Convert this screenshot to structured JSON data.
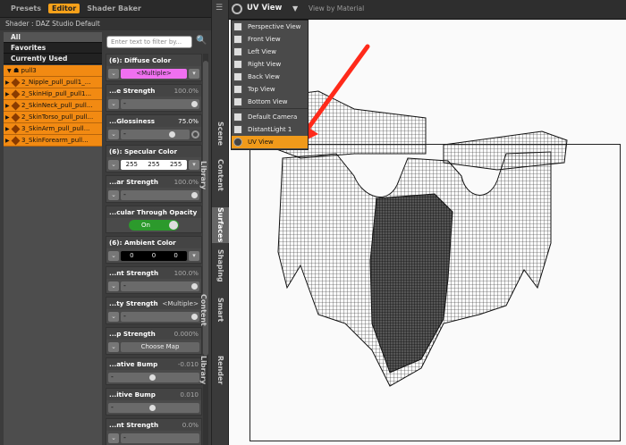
{
  "top_tabs": [
    "Presets",
    "Editor",
    "Shader Baker"
  ],
  "shader_title": "Shader : DAZ Studio Default",
  "filters": [
    "All",
    "Favorites",
    "Currently Used"
  ],
  "tree": {
    "root": "pull3",
    "items": [
      "2_Nipple_pull_pull1_...",
      "2_SkinHip_pull_pull1...",
      "2_SkinNeck_pull_pull...",
      "2_SkinTorso_pull_pull...",
      "3_SkinArm_pull_pull...",
      "3_SkinForearm_pull..."
    ]
  },
  "filter_placeholder": "Enter text to filter by...",
  "props": {
    "diffuse_color": {
      "label": "(6): Diffuse Color",
      "value": "<Multiple>"
    },
    "diffuse_strength": {
      "label": "...e Strength",
      "value": "100.0%"
    },
    "glossiness": {
      "label": "...Glossiness",
      "value": "75.0%"
    },
    "specular_color": {
      "label": "(6): Specular Color",
      "r": "255",
      "g": "255",
      "b": "255"
    },
    "specular_strength": {
      "label": "...ar Strength",
      "value": "100.0%"
    },
    "through_opacity": {
      "label": "...cular Through Opacity",
      "value": "On"
    },
    "ambient_color": {
      "label": "(6): Ambient Color",
      "r": "0",
      "g": "0",
      "b": "0"
    },
    "ambient_strength": {
      "label": "...nt Strength",
      "value": "100.0%"
    },
    "opacity_strength": {
      "label": "...ty Strength",
      "value": "<Multiple>"
    },
    "bump_strength": {
      "label": "...p Strength",
      "value": "0.000%",
      "button": "Choose Map"
    },
    "negative_bump": {
      "label": "...ative Bump",
      "value": "-0.010"
    },
    "positive_bump": {
      "label": "...itive Bump",
      "value": "0.010"
    },
    "last_strength": {
      "label": "...nt Strength",
      "value": "0.0%"
    }
  },
  "side_tabs": [
    "Scene",
    "Content Library",
    "Surfaces",
    "Shaping",
    "Smart Content",
    "Render Library"
  ],
  "viewport": {
    "title": "UV View",
    "mode": "View by Material"
  },
  "view_menu": [
    "Perspective View",
    "Front View",
    "Left View",
    "Right View",
    "Back View",
    "Top View",
    "Bottom View",
    "Default Camera",
    "DistantLight 1",
    "UV View"
  ],
  "colors": {
    "accent": "#f7a11a",
    "diffuse": "#f070f0",
    "toggle_on": "#2c9a2c",
    "arrow": "#ff2a1a"
  }
}
